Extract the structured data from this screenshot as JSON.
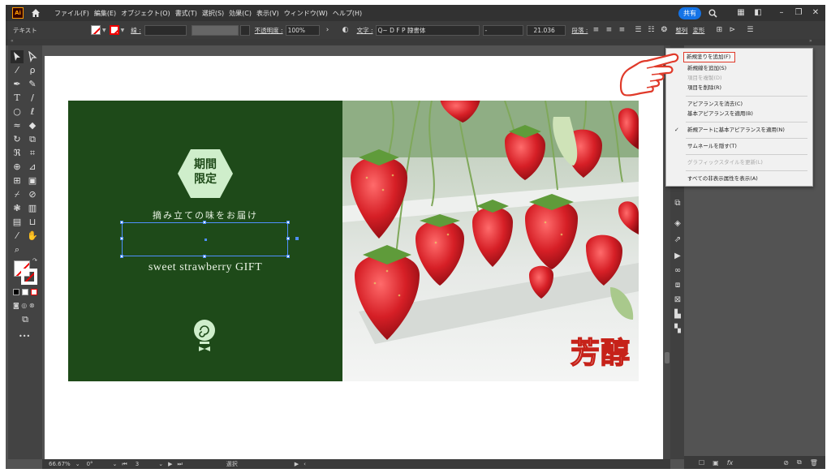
{
  "app": {
    "logo_text": "Ai",
    "menu": [
      "ファイル(F)",
      "編集(E)",
      "オブジェクト(O)",
      "書式(T)",
      "選択(S)",
      "効果(C)",
      "表示(V)",
      "ウィンドウ(W)",
      "ヘルプ(H)"
    ],
    "share_label": "共有"
  },
  "control_bar": {
    "object_type": "テキスト",
    "stroke_label": "線 :",
    "opacity_label": "不透明度 :",
    "opacity_value": "100%",
    "font_label": "文字 :",
    "font_name": "Q~ D F P 隷書体",
    "font_style": "-",
    "font_size": "21.036",
    "paragraph_label": "段落 :",
    "align_label": "整列",
    "transform_label": "変形"
  },
  "toolbar": {
    "tools": [
      "selection-tool",
      "direct-selection-tool",
      "magic-wand-tool",
      "lasso-tool",
      "pen-tool",
      "curvature-tool",
      "type-tool",
      "line-tool",
      "ellipse-tool",
      "paintbrush-tool",
      "shaper-tool",
      "eraser-tool",
      "rotate-tool",
      "scale-tool",
      "warp-tool",
      "free-transform-tool",
      "shape-builder-tool",
      "perspective-grid-tool",
      "mesh-tool",
      "gradient-tool",
      "eyedropper-tool",
      "blend-tool",
      "symbol-sprayer-tool",
      "column-graph-tool",
      "artboard-tool",
      "slice-tool",
      "hand-tool",
      "zoom-tool"
    ],
    "more_label": "•••"
  },
  "artwork": {
    "badge_line1": "期間",
    "badge_line2": "限定",
    "tagline": "摘み立ての味をお届け",
    "gift_text": "sweet strawberry GIFT",
    "title_kanji": "芳醇",
    "colors": {
      "panel_green": "#1e4a19",
      "badge_green": "#cfeecb",
      "strawberry_red": "#c62219"
    }
  },
  "status_bar": {
    "zoom": "66.67%",
    "rotation": "0°",
    "artboard_number": "3",
    "tool_name": "選択"
  },
  "flyout_menu": {
    "items": [
      {
        "label": "新規塗りを追加(F)",
        "enabled": true,
        "highlighted": true,
        "checked": false
      },
      {
        "label": "新規線を追加(S)",
        "enabled": true,
        "highlighted": false,
        "checked": false
      },
      {
        "label": "項目を複製(D)",
        "enabled": false,
        "highlighted": false,
        "checked": false
      },
      {
        "label": "項目を削除(R)",
        "enabled": true,
        "highlighted": false,
        "checked": false
      },
      {
        "label": "アピアランスを消去(C)",
        "enabled": true,
        "highlighted": false,
        "checked": false
      },
      {
        "label": "基本アピアランスを適用(B)",
        "enabled": true,
        "highlighted": false,
        "checked": false
      },
      {
        "label": "新規アートに基本アピアランスを適用(N)",
        "enabled": true,
        "highlighted": false,
        "checked": true
      },
      {
        "label": "サムネールを隠す(T)",
        "enabled": true,
        "highlighted": false,
        "checked": false
      },
      {
        "label": "グラフィックスタイルを更新(L)",
        "enabled": false,
        "highlighted": false,
        "checked": false
      },
      {
        "label": "すべての非表示属性を表示(A)",
        "enabled": true,
        "highlighted": false,
        "checked": false
      }
    ]
  },
  "icons": {
    "hand": "pointing-hand-icon",
    "fx": "fx-icon"
  },
  "panel_bottom": {
    "fx_label": "fx"
  }
}
